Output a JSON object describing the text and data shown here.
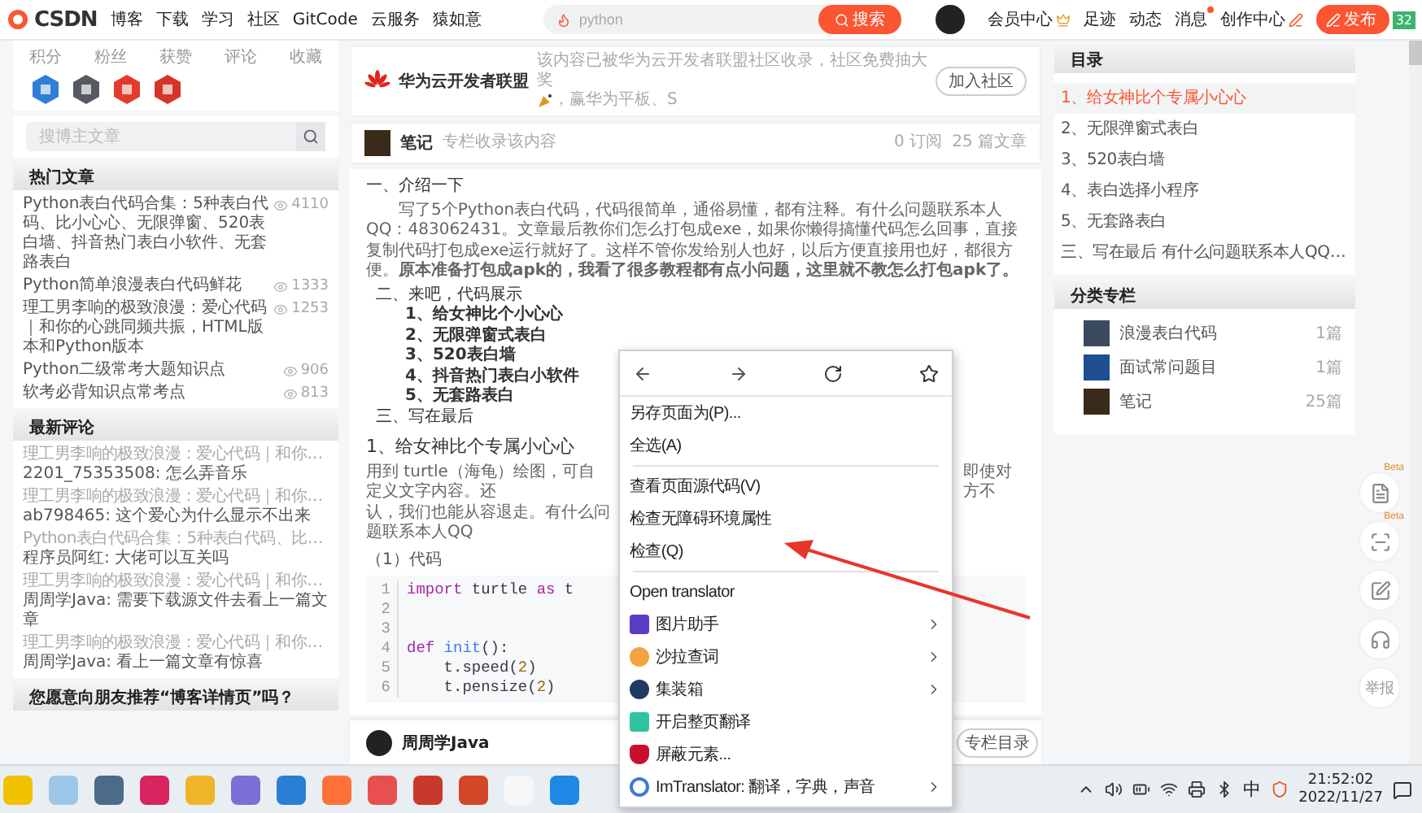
{
  "nav": {
    "logo": "CSDN",
    "links": [
      "博客",
      "下载",
      "学习",
      "社区",
      "GitCode",
      "云服务",
      "猿如意"
    ],
    "search": {
      "placeholder": "python",
      "button": "搜索"
    },
    "user_links": [
      {
        "label": "会员中心",
        "kind": "vip",
        "dot": false
      },
      {
        "label": "足迹",
        "kind": "plain",
        "dot": false
      },
      {
        "label": "动态",
        "kind": "plain",
        "dot": false
      },
      {
        "label": "消息",
        "kind": "plain",
        "dot": true
      },
      {
        "label": "创作中心",
        "kind": "creator",
        "dot": false
      }
    ],
    "publish_button": "发布",
    "corner_badge": "32"
  },
  "left": {
    "stats": [
      "积分",
      "粉丝",
      "获赞",
      "评论",
      "收藏"
    ],
    "blog_search": {
      "placeholder": "搜博主文章"
    },
    "hot_articles": {
      "title": "热门文章",
      "items": [
        {
          "title": "Python表白代码合集：5种表白代码、比小心心、无限弹窗、520表白墙、抖音热门表白小软件、无套路表白",
          "views": "4110"
        },
        {
          "title": "Python简单浪漫表白代码鲜花",
          "views": "1333"
        },
        {
          "title": "理工男李响的极致浪漫：爱心代码｜和你的心跳同频共振，HTML版本和Python版本",
          "views": "1253"
        },
        {
          "title": "Python二级常考大题知识点",
          "views": "906"
        },
        {
          "title": "软考必背知识点常考点",
          "views": "813"
        }
      ]
    },
    "latest_comments": {
      "title": "最新评论",
      "items": [
        {
          "article": "理工男李响的极致浪漫：爱心代码｜和你…",
          "comment": "2201_75353508: 怎么弄音乐"
        },
        {
          "article": "理工男李响的极致浪漫：爱心代码｜和你…",
          "comment": "ab798465: 这个爱心为什么显示不出来"
        },
        {
          "article": "Python表白代码合集：5种表白代码、比…",
          "comment": "程序员阿红: 大佬可以互关吗"
        },
        {
          "article": "理工男李响的极致浪漫：爱心代码｜和你…",
          "comment": "周周学Java: 需要下载源文件去看上一篇文章"
        },
        {
          "article": "理工男李响的极致浪漫：爱心代码｜和你…",
          "comment": "周周学Java: 看上一篇文章有惊喜"
        }
      ]
    },
    "survey": {
      "title": "您愿意向朋友推荐“博客详情页”吗？"
    }
  },
  "center": {
    "community": {
      "name": "华为云开发者联盟",
      "description": "该内容已被华为云开发者联盟社区收录，社区免费抽大奖",
      "description_tail": "，赢华为平板、S",
      "button": "加入社区"
    },
    "column": {
      "name": "笔记",
      "description": "专栏收录该内容",
      "subscribers": "0 订阅",
      "articles": "25 篇文章"
    },
    "article": {
      "intro_heading": "一、介绍一下",
      "intro_paragraph": "写了5个Python表白代码，代码很简单，通俗易懂，都有注释。有什么问题联系本人QQ：483062431。文章最后教你们怎么打包成exe，如果你懒得搞懂代码怎么回事，直接复制代码打包成exe运行就好了。这样不管你发给别人也好，以后方便直接用也好，都很方便。**原本准备打包成apk的，我看了很多教程都有点小问题，这里就不教怎么打包apk了。**",
      "outline": [
        {
          "text": "二、来吧，代码展示",
          "children": [
            {
              "text": "1、给女神比个小心心"
            },
            {
              "text": "2、无限弹窗式表白"
            },
            {
              "text": "3、520表白墙"
            },
            {
              "text": "4、抖音热门表白小软件"
            },
            {
              "text": "5、无套路表白"
            }
          ]
        },
        {
          "text": "三、写在最后"
        }
      ],
      "section_title": "1、给女神比个专属小心心",
      "section_paragraph": {
        "before": "用到 turtle（海龟）绘图，可自定义文字内容。还",
        "after": "即使对方不",
        "continued": "认，我们也能从容退走。有什么问题联系本人QQ"
      },
      "code_label": "（1）代码",
      "code": [
        {
          "number": "1",
          "tokens": [
            {
              "text": "import",
              "kind": "keyword"
            },
            {
              "text": " turtle ",
              "kind": "plain"
            },
            {
              "text": "as",
              "kind": "keyword"
            },
            {
              "text": " t",
              "kind": "plain"
            }
          ]
        },
        {
          "number": "2"
        },
        {
          "number": "3"
        },
        {
          "number": "4",
          "tokens": [
            {
              "text": "def",
              "kind": "keyword"
            },
            {
              "text": "init",
              "kind": "name"
            },
            {
              "text": "():",
              "kind": "plain"
            }
          ]
        },
        {
          "number": "5",
          "tokens": [
            {
              "text": "    t.speed(",
              "kind": "plain"
            },
            {
              "text": "2",
              "kind": "number"
            },
            {
              "text": ")",
              "kind": "plain"
            }
          ]
        },
        {
          "number": "6",
          "tokens": [
            {
              "text": "    t.pensize(",
              "kind": "plain"
            },
            {
              "text": "2",
              "kind": "number"
            },
            {
              "text": ")",
              "kind": "plain"
            }
          ]
        }
      ]
    },
    "author_bar": {
      "name": "周周学Java",
      "button": "专栏目录"
    }
  },
  "right": {
    "toc": {
      "title": "目录",
      "items": [
        {
          "label": "1、给女神比个专属小心心",
          "selected": true
        },
        {
          "label": "2、无限弹窗式表白",
          "selected": false
        },
        {
          "label": "3、520表白墙",
          "selected": false
        },
        {
          "label": "4、表白选择小程序",
          "selected": false
        },
        {
          "label": "5、无套路表白",
          "selected": false
        },
        {
          "label": "三、写在最后  有什么问题联系本人QQ…",
          "selected": false
        }
      ]
    },
    "categories": {
      "title": "分类专栏",
      "items": [
        {
          "name": "浪漫表白代码",
          "count": "1篇"
        },
        {
          "name": "面试常问题目",
          "count": "1篇"
        },
        {
          "name": "笔记",
          "count": "25篇"
        }
      ]
    }
  },
  "float_tools": [
    {
      "kind": "list",
      "beta": "Beta"
    },
    {
      "kind": "scan",
      "beta": "Beta"
    },
    {
      "kind": "edit"
    },
    {
      "kind": "support"
    },
    {
      "kind": "text",
      "label": "举报"
    }
  ],
  "context_menu": {
    "items": [
      {
        "kind": "plain",
        "label": "另存页面为(P)...",
        "submenu": false
      },
      {
        "kind": "plain",
        "label": "全选(A)",
        "submenu": false
      },
      {
        "kind": "separator"
      },
      {
        "kind": "plain",
        "label": "查看页面源代码(V)",
        "submenu": false
      },
      {
        "kind": "plain",
        "label": "检查无障碍环境属性",
        "submenu": false
      },
      {
        "kind": "plain",
        "label": "检查(Q)",
        "submenu": false
      },
      {
        "kind": "separator"
      },
      {
        "kind": "plain",
        "label": "Open translator",
        "submenu": false
      },
      {
        "kind": "extension",
        "label": "图片助手",
        "submenu": true
      },
      {
        "kind": "extension",
        "label": "沙拉查词",
        "submenu": true
      },
      {
        "kind": "extension",
        "label": "集装箱",
        "submenu": true
      },
      {
        "kind": "extension",
        "label": "开启整页翻译",
        "submenu": false
      },
      {
        "kind": "extension",
        "label": "屏蔽元素...",
        "submenu": false
      },
      {
        "kind": "extension",
        "label": "ImTranslator: 翻译，字典，声音",
        "submenu": true
      }
    ]
  },
  "taskbar": {
    "ime": "中",
    "time": "21:52:02",
    "date": "2022/11/27"
  }
}
